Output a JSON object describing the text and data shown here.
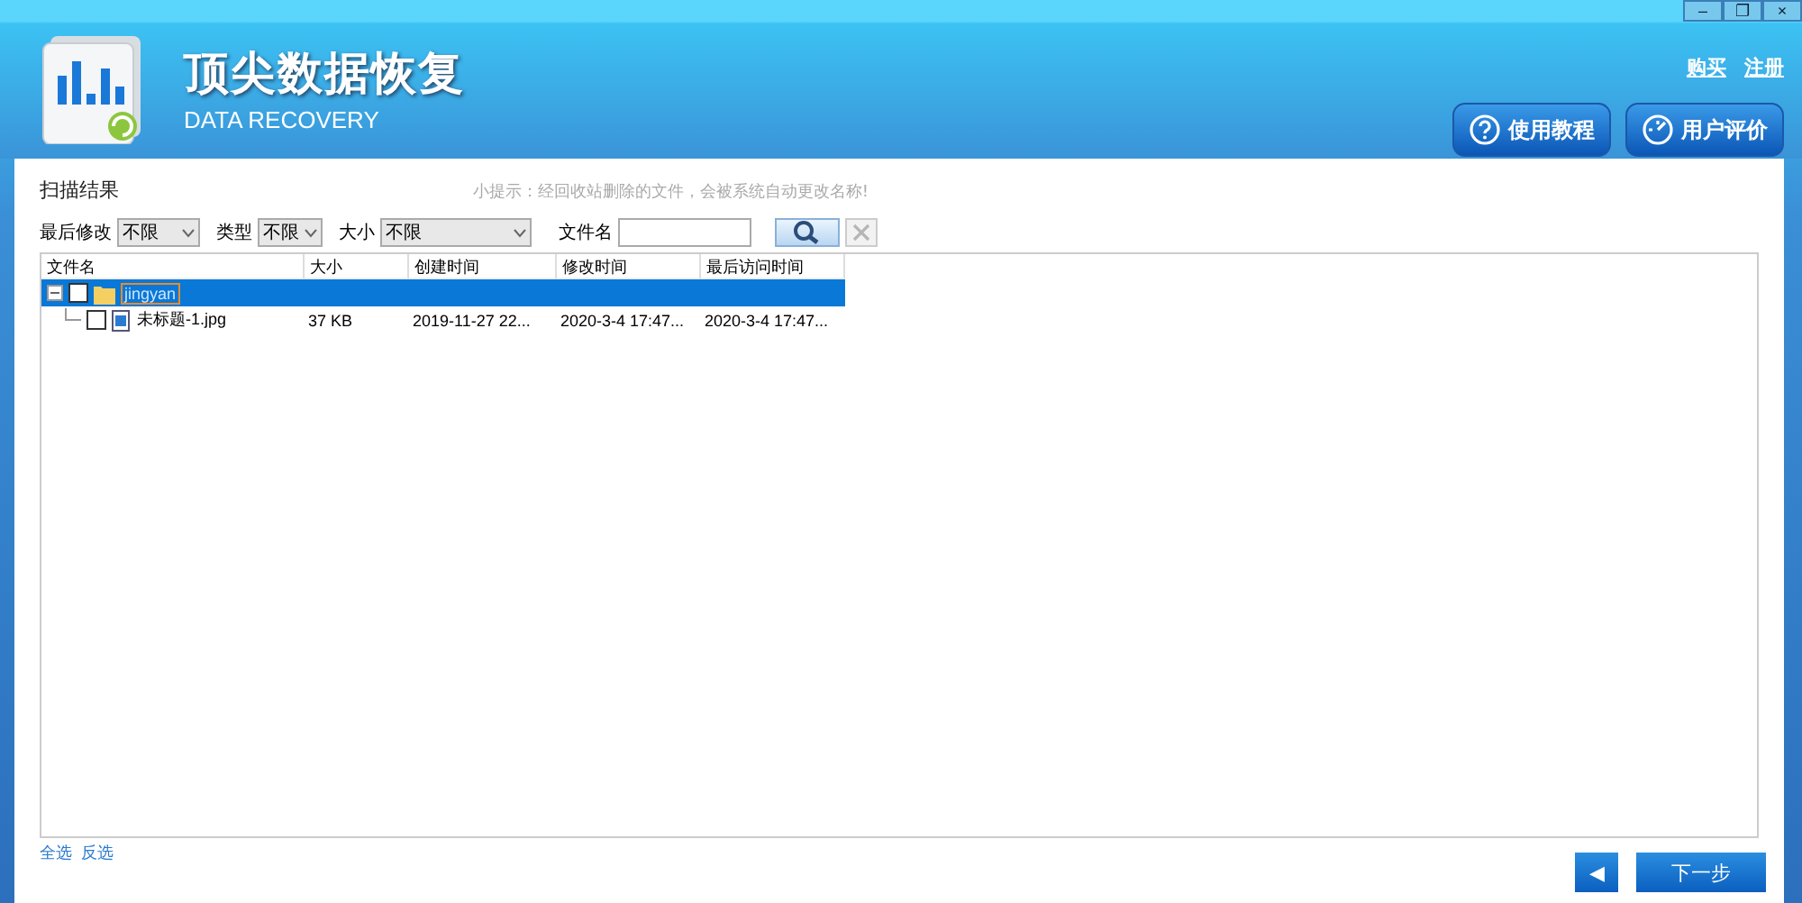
{
  "window": {
    "controls": [
      "–",
      "❐",
      "×"
    ]
  },
  "header": {
    "title": "顶尖数据恢复",
    "subtitle": "DATA RECOVERY",
    "links": [
      "购买",
      "注册"
    ],
    "buttons": [
      {
        "kind": "help",
        "label": "使用教程"
      },
      {
        "kind": "review",
        "label": "用户评价"
      }
    ]
  },
  "scan": {
    "title": "扫描结果",
    "hint": "小提示：经回收站删除的文件，会被系统自动更改名称!"
  },
  "filters": [
    {
      "label": "最后修改",
      "value": "不限",
      "kind": "short"
    },
    {
      "label": "类型",
      "value": "不限",
      "kind": "tiny"
    },
    {
      "label": "大小",
      "value": "不限",
      "kind": "wide"
    }
  ],
  "filename_filter": {
    "label": "文件名"
  },
  "table": {
    "columns": [
      "文件名",
      "大小",
      "创建时间",
      "修改时间",
      "最后访问时间"
    ],
    "rows": [
      {
        "kind": "folder",
        "expanded": true,
        "checked": false,
        "selected": true,
        "cells": [
          "jingyan",
          "",
          "",
          "",
          ""
        ],
        "children": [
          {
            "kind": "image",
            "checked": false,
            "selected": false,
            "cells": [
              "未标题-1.jpg",
              "37 KB",
              "2019-11-27 22...",
              "2020-3-4 17:47...",
              "2020-3-4 17:47..."
            ]
          }
        ]
      }
    ]
  },
  "footer": {
    "links": [
      "全选",
      "反选"
    ],
    "back": "◀",
    "next": "下一步"
  }
}
